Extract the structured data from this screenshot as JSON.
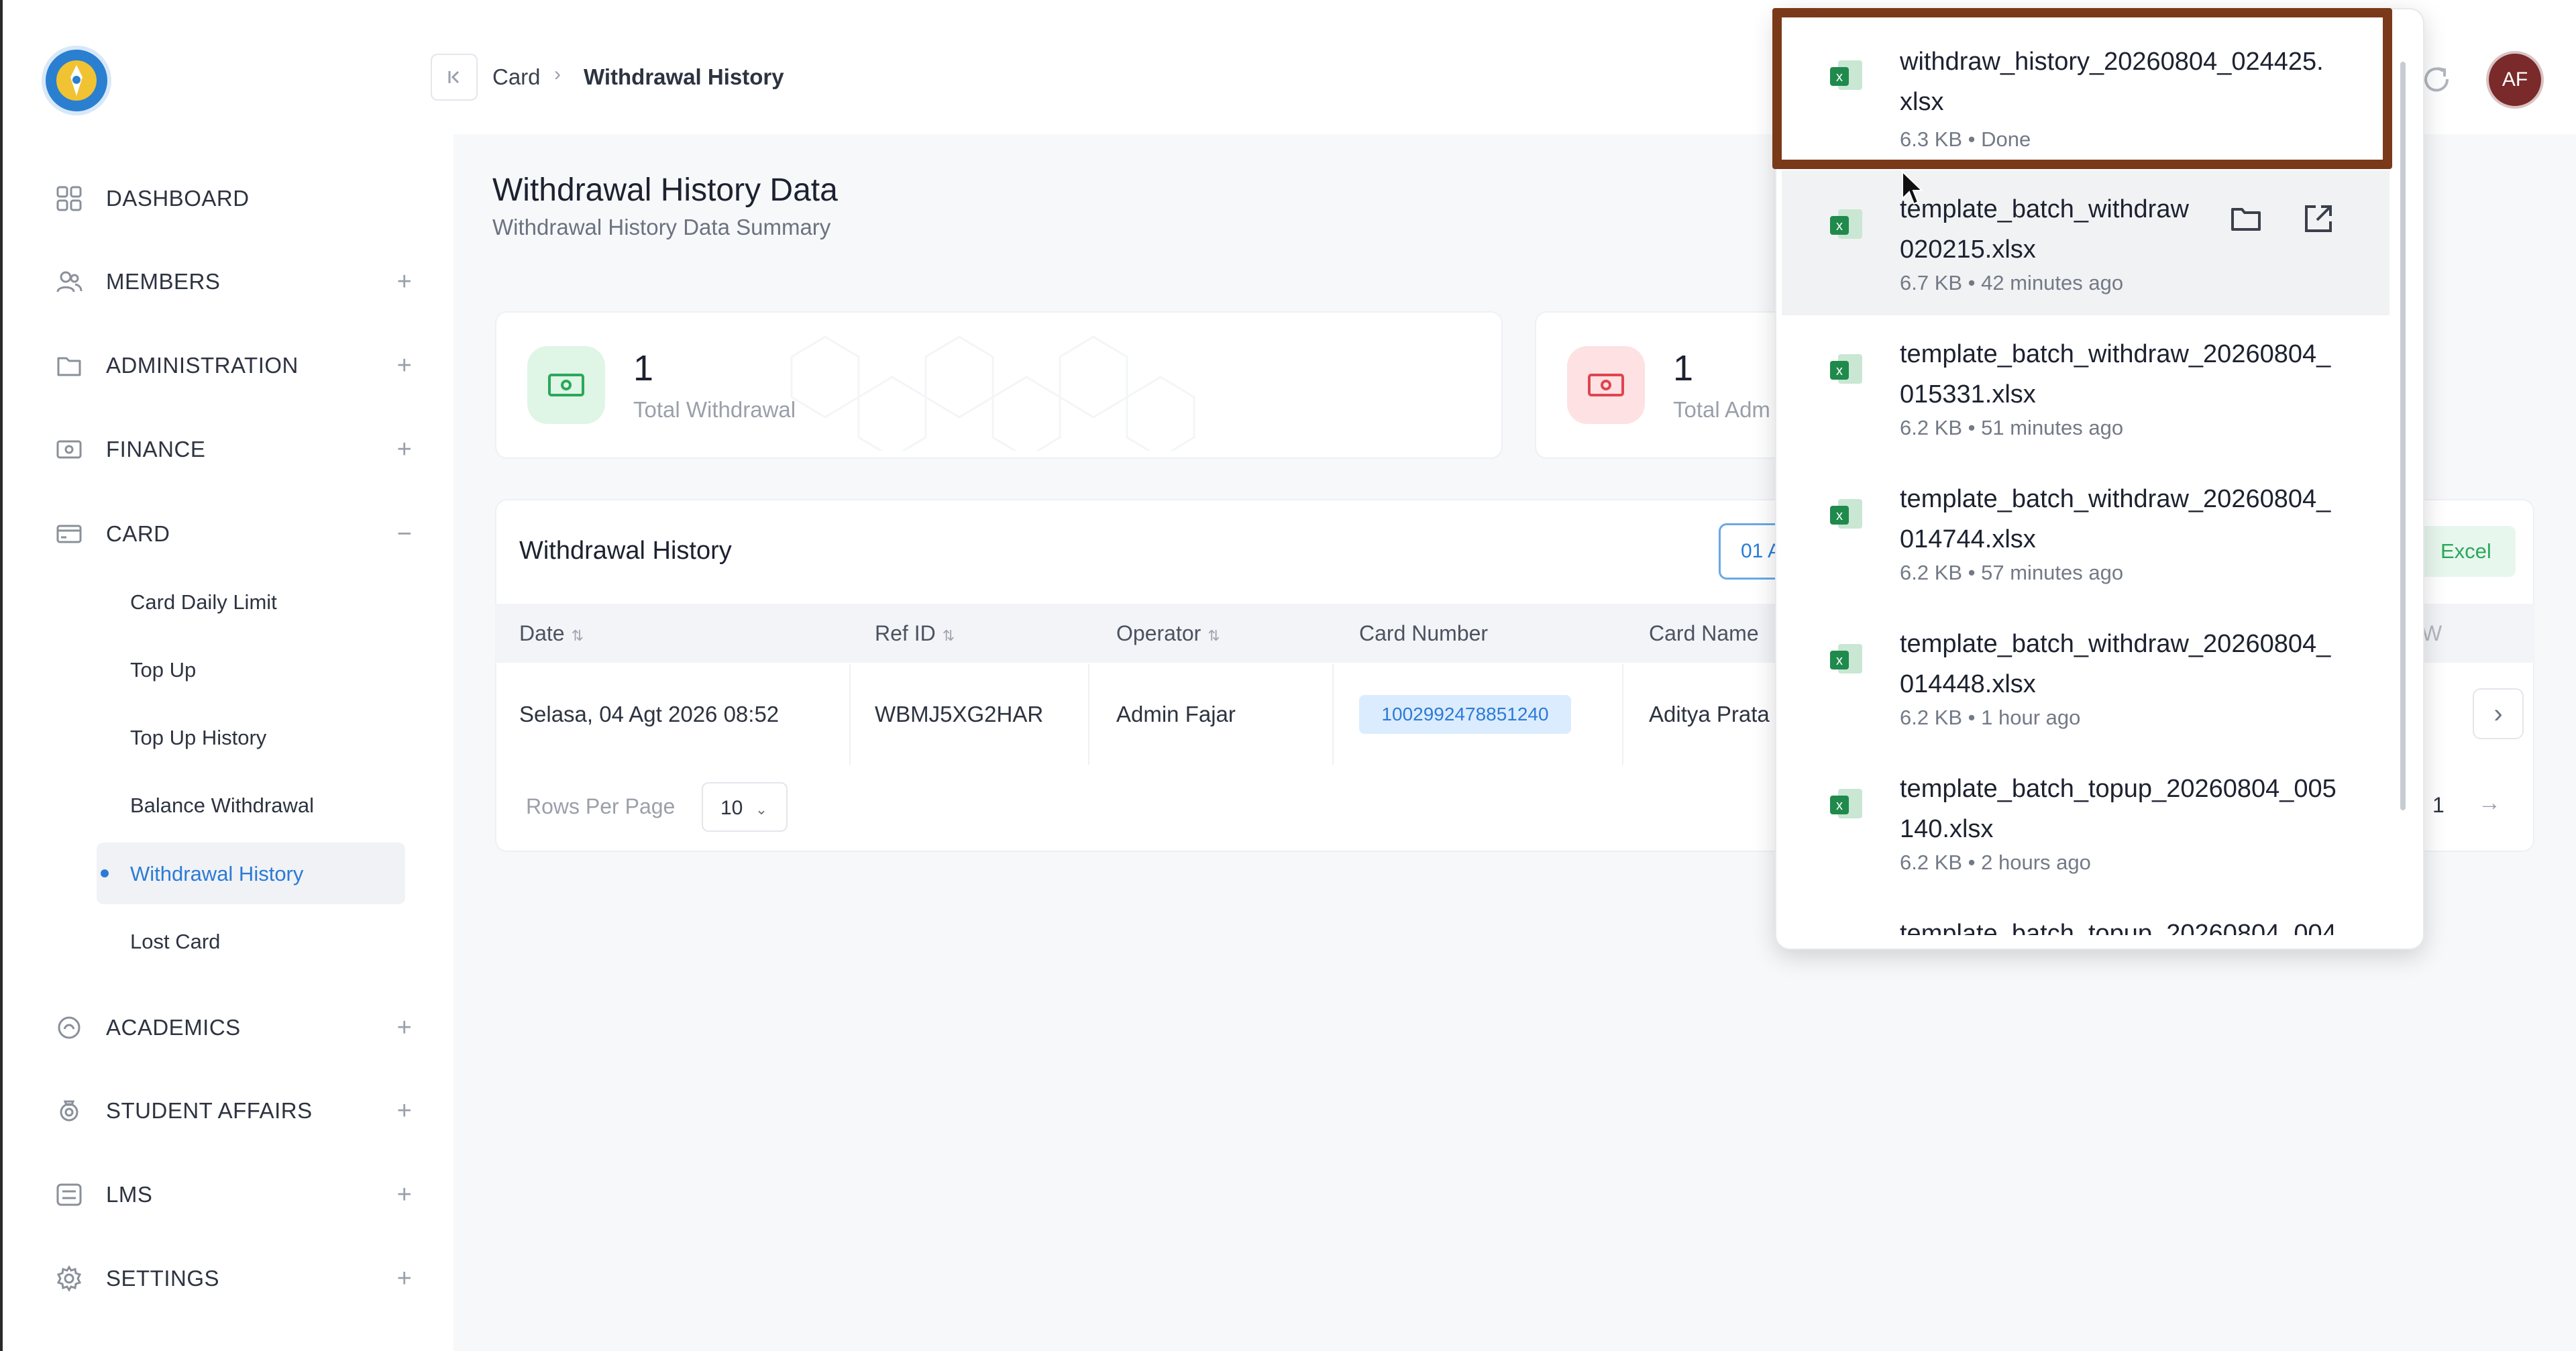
{
  "breadcrumb": {
    "parent": "Card",
    "current": "Withdrawal History"
  },
  "user": {
    "initials": "AF"
  },
  "sidebar": {
    "items": [
      {
        "label": "DASHBOARD",
        "icon": "grid-icon",
        "expandable": false
      },
      {
        "label": "MEMBERS",
        "icon": "users-icon",
        "expandable": true
      },
      {
        "label": "ADMINISTRATION",
        "icon": "folder-icon",
        "expandable": true
      },
      {
        "label": "FINANCE",
        "icon": "money-icon",
        "expandable": true
      },
      {
        "label": "CARD",
        "icon": "card-icon",
        "expandable": true,
        "expanded": true
      },
      {
        "label": "ACADEMICS",
        "icon": "academics-icon",
        "expandable": true
      },
      {
        "label": "STUDENT AFFAIRS",
        "icon": "badge-icon",
        "expandable": true
      },
      {
        "label": "LMS",
        "icon": "list-icon",
        "expandable": true
      },
      {
        "label": "SETTINGS",
        "icon": "gear-icon",
        "expandable": true
      }
    ],
    "card_subitems": [
      "Card Daily Limit",
      "Top Up",
      "Top Up History",
      "Balance Withdrawal",
      "Withdrawal History",
      "Lost Card"
    ],
    "active_subitem": "Withdrawal History"
  },
  "page": {
    "title": "Withdrawal History Data",
    "subtitle": "Withdrawal History Data Summary"
  },
  "stats": [
    {
      "value": "1",
      "label": "Total Withdrawal",
      "color": "#2aa85a"
    },
    {
      "value": "1",
      "label": "Total Adm",
      "color": "#e0454f"
    }
  ],
  "table": {
    "title": "Withdrawal History",
    "date_button": "01 A",
    "export_label": "Excel",
    "columns": [
      "Date",
      "Ref ID",
      "Operator",
      "Card Number",
      "Card Name"
    ],
    "truncated_column": "W",
    "rows": [
      {
        "date": "Selasa, 04 Agt 2026 08:52",
        "ref_id": "WBMJ5XG2HAR",
        "operator": "Admin Fajar",
        "card_number": "1002992478851240",
        "card_name": "Aditya Prata"
      }
    ],
    "rows_per_page_label": "Rows Per Page",
    "rows_per_page": "10",
    "page_number": "1"
  },
  "downloads": [
    {
      "name": "withdraw_history_20260804_024425.\nxlsx",
      "meta": "6.3 KB • Done",
      "highlighted": true
    },
    {
      "name": "template_batch_withdraw\n020215.xlsx",
      "meta": "6.7 KB • 42 minutes ago",
      "hover": true
    },
    {
      "name": "template_batch_withdraw_20260804_\n015331.xlsx",
      "meta": "6.2 KB • 51 minutes ago"
    },
    {
      "name": "template_batch_withdraw_20260804_\n014744.xlsx",
      "meta": "6.2 KB • 57 minutes ago"
    },
    {
      "name": "template_batch_withdraw_20260804_\n014448.xlsx",
      "meta": "6.2 KB • 1 hour ago"
    },
    {
      "name": "template_batch_topup_20260804_005\n140.xlsx",
      "meta": "6.2 KB • 2 hours ago"
    },
    {
      "name": "template_batch_topup_20260804_004",
      "meta": "",
      "partial": true
    }
  ],
  "colors": {
    "accent": "#2b7bd6",
    "highlight_border": "#7a3a1a",
    "excel_green": "#2aa85a"
  }
}
